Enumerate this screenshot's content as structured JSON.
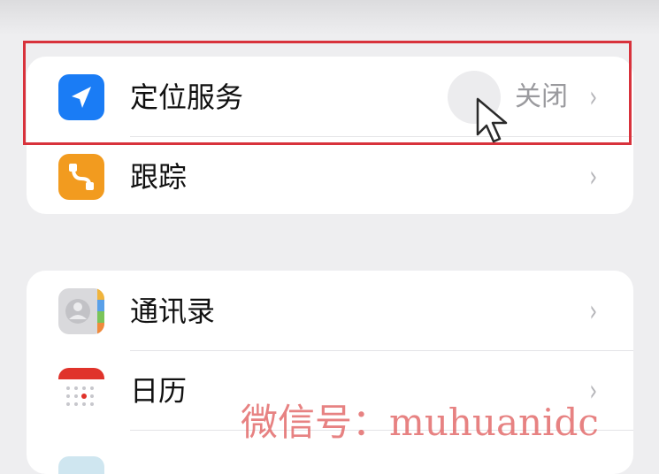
{
  "privacy_group": {
    "location": {
      "label": "定位服务",
      "value": "关闭",
      "icon": "location-arrow-icon",
      "icon_color": "#1a7cf5"
    },
    "tracking": {
      "label": "跟踪",
      "icon": "tracking-icon",
      "icon_color": "#f29b1f"
    }
  },
  "apps_group": {
    "contacts": {
      "label": "通讯录",
      "icon": "contacts-icon"
    },
    "calendar": {
      "label": "日历",
      "icon": "calendar-icon",
      "accent": "#e0332b"
    }
  },
  "highlight_color": "#d8323c",
  "watermark": "微信号：muhuanidc"
}
